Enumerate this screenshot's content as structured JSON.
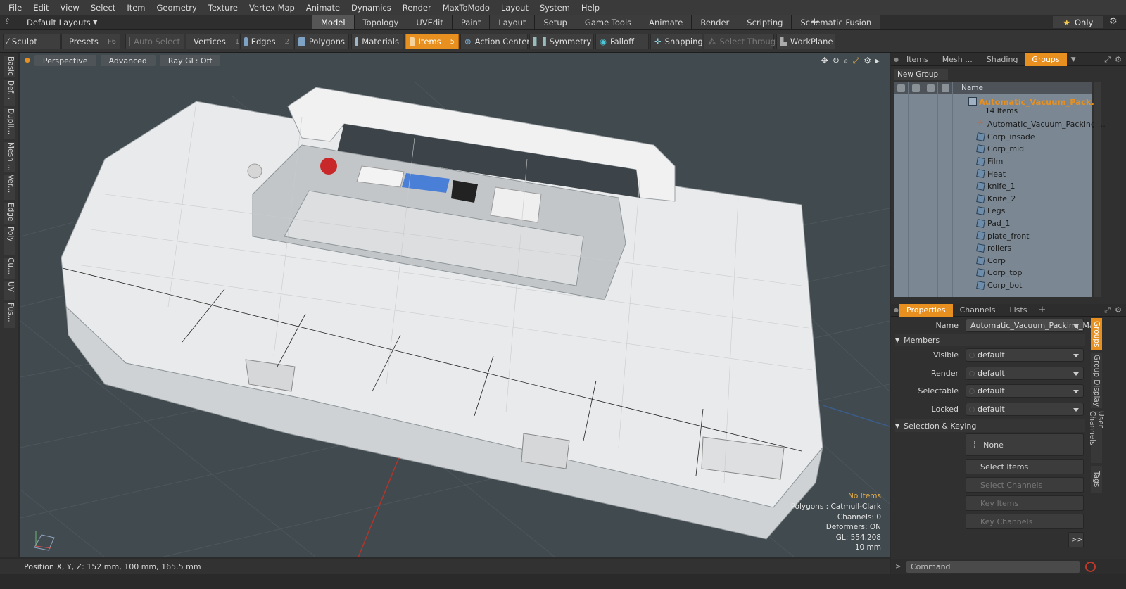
{
  "menu": [
    "File",
    "Edit",
    "View",
    "Select",
    "Item",
    "Geometry",
    "Texture",
    "Vertex Map",
    "Animate",
    "Dynamics",
    "Render",
    "MaxToModo",
    "Layout",
    "System",
    "Help"
  ],
  "layouts": {
    "label": "Default Layouts"
  },
  "mode_tabs": [
    "Model",
    "Topology",
    "UVEdit",
    "Paint",
    "Layout",
    "Setup",
    "Game Tools",
    "Animate",
    "Render",
    "Scripting",
    "Schematic Fusion"
  ],
  "mode_tabs_active": "Model",
  "only_btn": {
    "label": "Only",
    "icon": "star-icon"
  },
  "toolbar": {
    "sculpt": "Sculpt",
    "presets": "Presets",
    "presets_shortcut": "F6",
    "auto_select": "Auto Select",
    "vertices": "Vertices",
    "vertices_shortcut": "1",
    "edges": "Edges",
    "edges_shortcut": "2",
    "polygons": "Polygons",
    "materials": "Materials",
    "items": "Items",
    "items_shortcut": "5",
    "action_center": "Action Center",
    "symmetry": "Symmetry",
    "falloff": "Falloff",
    "snapping": "Snapping",
    "select_through": "Select Through",
    "workplane": "WorkPlane"
  },
  "left_tabs": [
    "Basic",
    "Def...",
    "Dupli...",
    "Mesh ...",
    "Ver...",
    "Edge",
    "Poly",
    "Cu...",
    "UV",
    "Fus..."
  ],
  "viewport": {
    "view": "Perspective",
    "shading": "Advanced",
    "raygl": "Ray GL: Off",
    "info": {
      "items": "No Items",
      "polygons": "Polygons : Catmull-Clark",
      "channels": "Channels: 0",
      "deformers": "Deformers: ON",
      "gl": "GL: 554,208",
      "scale": "10 mm"
    }
  },
  "status": {
    "position": "Position X, Y, Z:  152 mm, 100 mm, 165.5 mm"
  },
  "groups_panel": {
    "tabs": [
      "Items",
      "Mesh ...",
      "Shading",
      "Groups"
    ],
    "active_tab": "Groups",
    "new_group": "New Group",
    "col_name": "Name",
    "group_name": "Automatic_Vacuum_Pack...",
    "group_count": "14 Items",
    "children": [
      "Automatic_Vacuum_Packing ...",
      "Corp_insade",
      "Corp_mid",
      "Film",
      "Heat",
      "knife_1",
      "Knife_2",
      "Legs",
      "Pad_1",
      "plate_front",
      "rollers",
      "Corp",
      "Corp_top",
      "Corp_bot"
    ]
  },
  "properties": {
    "tabs": [
      "Properties",
      "Channels",
      "Lists"
    ],
    "active_tab": "Properties",
    "name_label": "Name",
    "name_value": "Automatic_Vacuum_Packing_Mac",
    "members": "Members",
    "visible_label": "Visible",
    "visible_value": "default",
    "render_label": "Render",
    "render_value": "default",
    "selectable_label": "Selectable",
    "selectable_value": "default",
    "locked_label": "Locked",
    "locked_value": "default",
    "sel_keying": "Selection & Keying",
    "none_btn": "None",
    "select_items": "Select Items",
    "select_channels": "Select Channels",
    "key_items": "Key Items",
    "key_channels": "Key Channels",
    "more": ">>",
    "side_tabs": [
      "Groups",
      "Group Display",
      "User Channels",
      "Tags"
    ]
  },
  "command": {
    "placeholder": "Command"
  },
  "colors": {
    "accent": "#e8901f",
    "viewport_bg": "#414a4f",
    "panel_bg": "#303030"
  }
}
